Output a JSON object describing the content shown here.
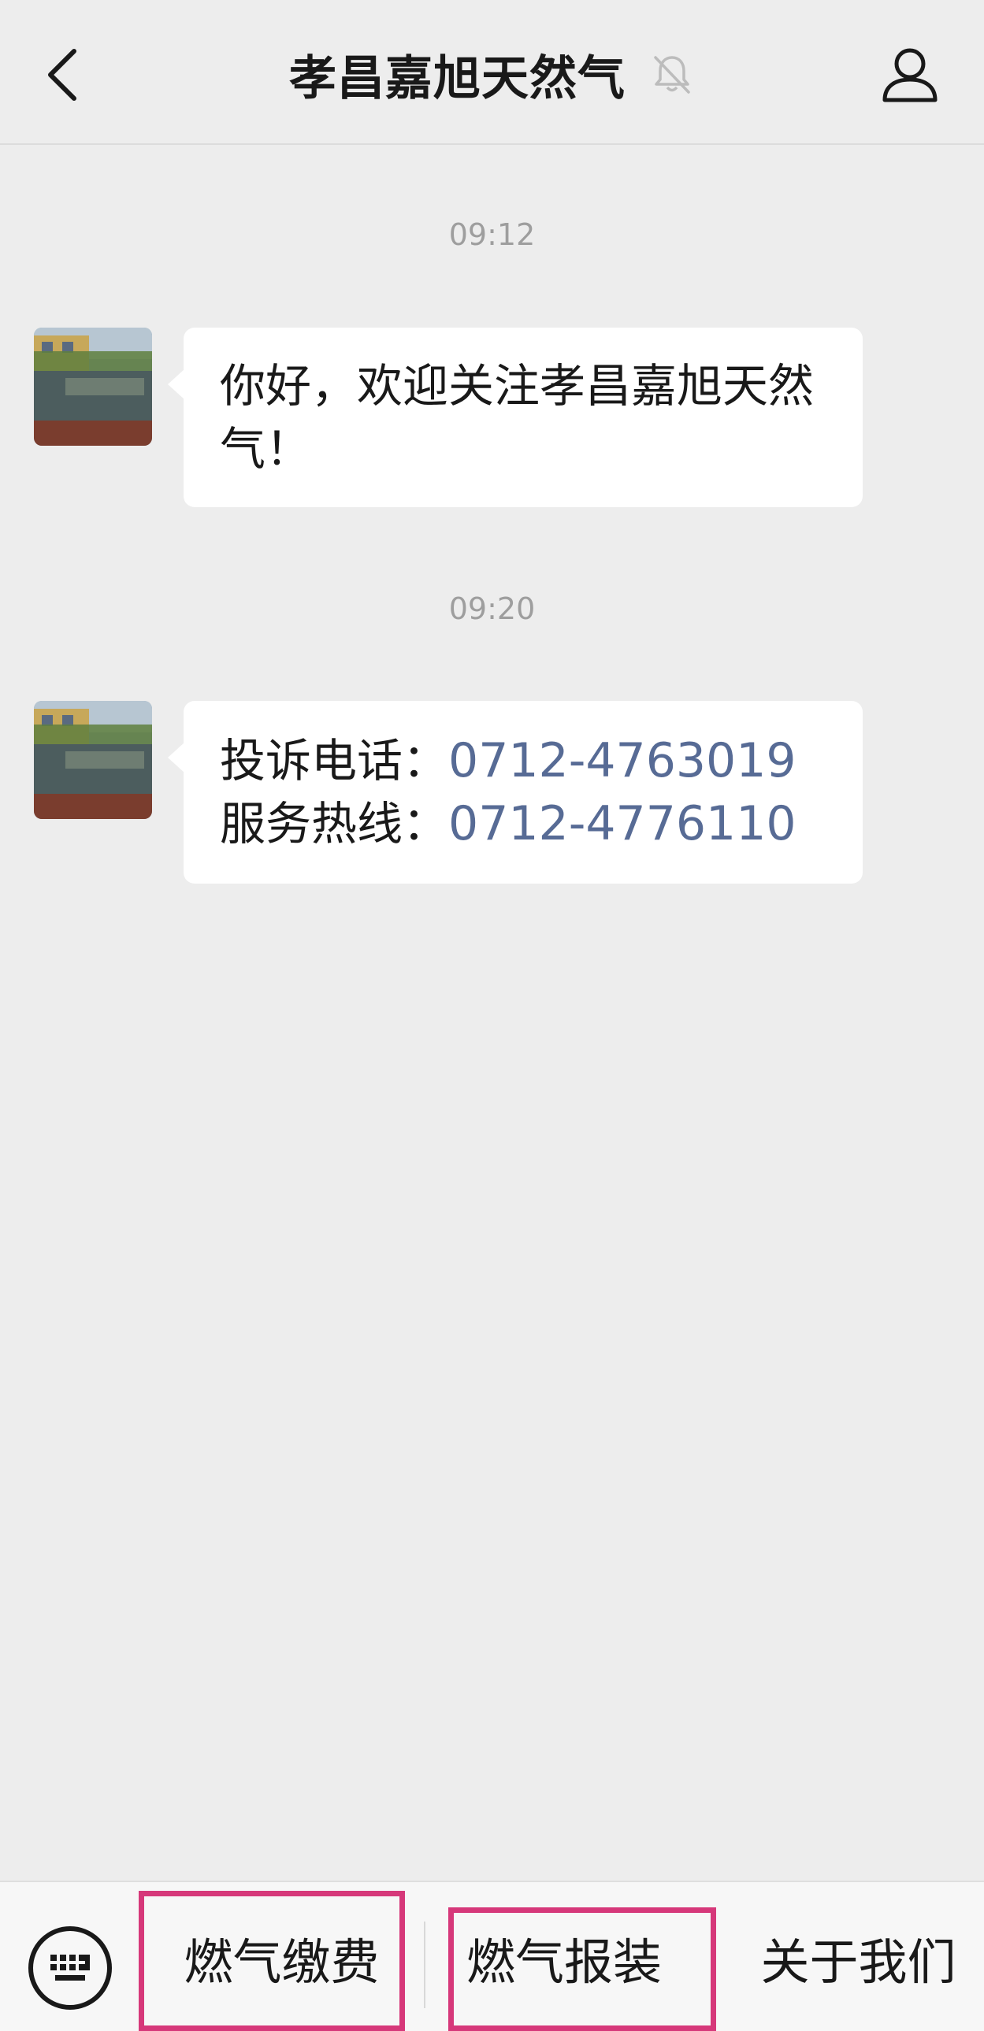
{
  "header": {
    "title": "孝昌嘉旭天然气",
    "back_icon": "chevron-left-icon",
    "mute_icon": "bell-muted-icon",
    "profile_icon": "person-icon"
  },
  "messages": [
    {
      "time": "09:12",
      "text": "你好，欢迎关注孝昌嘉旭天然气！"
    },
    {
      "time": "09:20",
      "lines": [
        {
          "label": "投诉电话：",
          "number": "0712-4763019"
        },
        {
          "label": "服务热线：",
          "number": "0712-4776110"
        }
      ]
    }
  ],
  "menu": {
    "keyboard_icon": "keyboard-icon",
    "items": [
      {
        "label": "燃气缴费"
      },
      {
        "label": "燃气报装"
      },
      {
        "label": "关于我们"
      }
    ]
  },
  "colors": {
    "background": "#ededed",
    "link": "#576b95",
    "highlight": "#d6387a"
  }
}
